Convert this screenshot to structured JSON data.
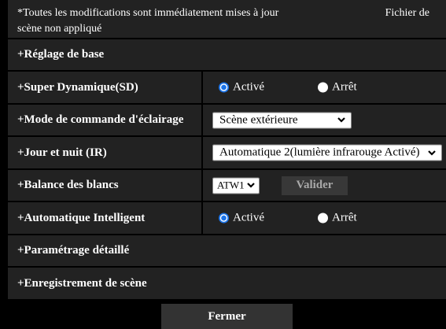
{
  "colors": {
    "background": "#000000",
    "panel": "#222222",
    "accent": "#1a73e8",
    "button": "#333333"
  },
  "icons": {
    "select_arrow": "chevron-down-icon",
    "radio": "radio-button-icon"
  },
  "header": {
    "note": "*Toutes les modifications sont immédiatement mises à jour",
    "status_line1": "Fichier de",
    "status_line2": "scène non appliqué"
  },
  "sections": {
    "basic": {
      "label": "+Réglage de base"
    },
    "super_dynamic": {
      "label": "+Super Dynamique(SD)",
      "options": [
        {
          "label": "Activé",
          "checked": true
        },
        {
          "label": "Arrêt",
          "checked": false
        }
      ]
    },
    "lighting_control": {
      "label": "+Mode de commande d'éclairage",
      "value": "Scène extérieure"
    },
    "day_night": {
      "label": "+Jour et nuit (IR)",
      "value": "Automatique 2(lumière infrarouge Activé)"
    },
    "white_balance": {
      "label": "+Balance des blancs",
      "value": "ATW1",
      "apply_label": "Valider"
    },
    "intelligent_auto": {
      "label": "+Automatique Intelligent",
      "options": [
        {
          "label": "Activé",
          "checked": true
        },
        {
          "label": "Arrêt",
          "checked": false
        }
      ]
    },
    "detailed": {
      "label": "+Paramétrage détaillé"
    },
    "scene_recording": {
      "label": "+Enregistrement de scène"
    }
  },
  "close_label": "Fermer"
}
